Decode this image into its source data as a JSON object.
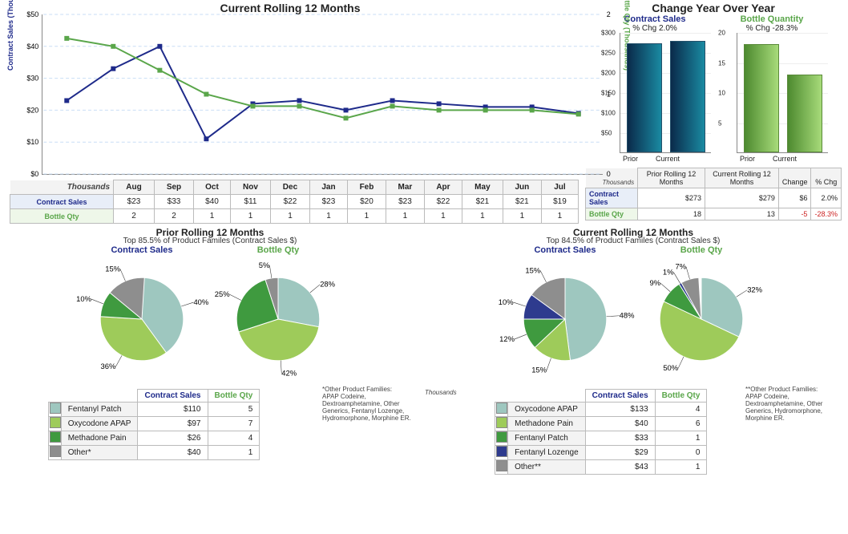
{
  "colors": {
    "teal": "#9ec7bf",
    "lime": "#9ecb5a",
    "green": "#3f9a3f",
    "navy": "#2e3b8e",
    "grey": "#8e8e8e"
  },
  "chart_data": [
    {
      "id": "rolling12",
      "type": "line",
      "title": "Current Rolling 12 Months",
      "x": [
        "Aug",
        "Sep",
        "Oct",
        "Nov",
        "Dec",
        "Jan",
        "Feb",
        "Mar",
        "Apr",
        "May",
        "Jun",
        "Jul"
      ],
      "y1": {
        "label": "Contract Sales (Thousands)",
        "ylim": [
          0,
          50
        ],
        "ticks": [
          "$0",
          "$10",
          "$20",
          "$30",
          "$40",
          "$50"
        ]
      },
      "y2": {
        "label": "Bottle Qty (Thousands)",
        "ylim": [
          0,
          2
        ],
        "ticks": [
          "0",
          "1",
          "2"
        ]
      },
      "series": [
        {
          "name": "Contract Sales",
          "axis": "y1",
          "color": "#1e2a8a",
          "values": [
            23,
            33,
            40,
            11,
            22,
            23,
            20,
            23,
            22,
            21,
            21,
            19
          ]
        },
        {
          "name": "Bottle Qty",
          "axis": "y2",
          "color": "#5aa64a",
          "values": [
            1.7,
            1.6,
            1.3,
            1.0,
            0.85,
            0.85,
            0.7,
            0.85,
            0.8,
            0.8,
            0.8,
            0.75
          ]
        }
      ]
    },
    {
      "id": "yoy_sales",
      "type": "bar",
      "title": "Contract Sales",
      "subtitle": "% Chg 2.0%",
      "categories": [
        "Prior",
        "Current"
      ],
      "values": [
        273,
        279
      ],
      "ylim": [
        0,
        300
      ],
      "ticks": [
        "$50",
        "$100",
        "$150",
        "$200",
        "$250",
        "$300"
      ]
    },
    {
      "id": "yoy_qty",
      "type": "bar",
      "title": "Bottle Quantity",
      "subtitle": "% Chg -28.3%",
      "categories": [
        "Prior",
        "Current"
      ],
      "values": [
        18,
        13
      ],
      "ylim": [
        0,
        20
      ],
      "ticks": [
        "5",
        "10",
        "15",
        "20"
      ]
    },
    {
      "id": "prior_sales_pie",
      "type": "pie",
      "title": "Contract Sales",
      "slices": [
        {
          "label": "Fentanyl Patch",
          "pct": 40,
          "color": "teal"
        },
        {
          "label": "Oxycodone APAP",
          "pct": 36,
          "color": "lime"
        },
        {
          "label": "Methadone Pain",
          "pct": 10,
          "color": "green"
        },
        {
          "label": "Other*",
          "pct": 15,
          "color": "grey"
        }
      ]
    },
    {
      "id": "prior_qty_pie",
      "type": "pie",
      "title": "Bottle Qty",
      "slices": [
        {
          "label": "Fentanyl Patch",
          "pct": 28,
          "color": "teal"
        },
        {
          "label": "Oxycodone APAP",
          "pct": 42,
          "color": "lime"
        },
        {
          "label": "Methadone Pain",
          "pct": 25,
          "color": "green"
        },
        {
          "label": "Other*",
          "pct": 5,
          "color": "grey"
        }
      ]
    },
    {
      "id": "curr_sales_pie",
      "type": "pie",
      "title": "Contract Sales",
      "slices": [
        {
          "label": "Oxycodone APAP",
          "pct": 48,
          "color": "teal"
        },
        {
          "label": "Methadone Pain",
          "pct": 15,
          "color": "lime"
        },
        {
          "label": "Fentanyl Patch",
          "pct": 12,
          "color": "green"
        },
        {
          "label": "Fentanyl Lozenge",
          "pct": 10,
          "color": "navy"
        },
        {
          "label": "Other**",
          "pct": 15,
          "color": "grey"
        }
      ]
    },
    {
      "id": "curr_qty_pie",
      "type": "pie",
      "title": "Bottle Qty",
      "slices": [
        {
          "label": "Oxycodone APAP",
          "pct": 32,
          "color": "teal"
        },
        {
          "label": "Methadone Pain",
          "pct": 50,
          "color": "lime"
        },
        {
          "label": "Fentanyl Patch",
          "pct": 9,
          "color": "green"
        },
        {
          "label": "Fentanyl Lozenge",
          "pct": 1,
          "color": "navy"
        },
        {
          "label": "Other**",
          "pct": 7,
          "color": "grey"
        }
      ]
    }
  ],
  "header": {
    "main_title": "Current Rolling 12 Months",
    "right_title": "Change Year Over Year",
    "thousands": "Thousands"
  },
  "month_table": {
    "months": [
      "Aug",
      "Sep",
      "Oct",
      "Nov",
      "Dec",
      "Jan",
      "Feb",
      "Mar",
      "Apr",
      "May",
      "Jun",
      "Jul"
    ],
    "rows": {
      "contract_sales": {
        "label": "Contract Sales",
        "values": [
          "$23",
          "$33",
          "$40",
          "$11",
          "$22",
          "$23",
          "$20",
          "$23",
          "$22",
          "$21",
          "$21",
          "$19"
        ]
      },
      "bottle_qty": {
        "label": "Bottle Qty",
        "values": [
          "2",
          "2",
          "1",
          "1",
          "1",
          "1",
          "1",
          "1",
          "1",
          "1",
          "1",
          "1"
        ]
      }
    }
  },
  "summary_table": {
    "cols": [
      "Prior Rolling 12 Months",
      "Current Rolling 12 Months",
      "Change",
      "% Chg"
    ],
    "rows": [
      {
        "label": "Contract Sales",
        "class": "cs",
        "cells": [
          "$273",
          "$279",
          "$6",
          "2.0%"
        ],
        "chg_class": ""
      },
      {
        "label": "Bottle Qty",
        "class": "bq",
        "cells": [
          "18",
          "13",
          "-5",
          "-28.3%"
        ],
        "chg_class": "red"
      }
    ]
  },
  "prior_section": {
    "title": "Prior Rolling 12 Months",
    "subtitle": "Top 85.5% of Product Familes (Contract Sales $)",
    "sales_label": "Contract Sales",
    "qty_label": "Bottle Qty",
    "table": {
      "cols": [
        "Contract Sales",
        "Bottle Qty"
      ],
      "rows": [
        {
          "color": "teal",
          "name": "Fentanyl Patch",
          "cs": "$110",
          "bq": "5"
        },
        {
          "color": "lime",
          "name": "Oxycodone APAP",
          "cs": "$97",
          "bq": "7"
        },
        {
          "color": "green",
          "name": "Methadone Pain",
          "cs": "$26",
          "bq": "4"
        },
        {
          "color": "grey",
          "name": "Other*",
          "cs": "$40",
          "bq": "1"
        }
      ]
    },
    "footnote": "*Other Product Families:\nAPAP Codeine, Dextroamphetamine, Other Generics, Fentanyl Lozenge, Hydromorphone, Morphine ER."
  },
  "current_section": {
    "title": "Current Rolling 12 Months",
    "subtitle": "Top 84.5% of Product Familes (Contract Sales $)",
    "sales_label": "Contract Sales",
    "qty_label": "Bottle Qty",
    "table": {
      "cols": [
        "Contract Sales",
        "Bottle Qty"
      ],
      "rows": [
        {
          "color": "teal",
          "name": "Oxycodone APAP",
          "cs": "$133",
          "bq": "4"
        },
        {
          "color": "lime",
          "name": "Methadone Pain",
          "cs": "$40",
          "bq": "6"
        },
        {
          "color": "green",
          "name": "Fentanyl Patch",
          "cs": "$33",
          "bq": "1"
        },
        {
          "color": "navy",
          "name": "Fentanyl Lozenge",
          "cs": "$29",
          "bq": "0"
        },
        {
          "color": "grey",
          "name": "Other**",
          "cs": "$43",
          "bq": "1"
        }
      ]
    },
    "footnote": "**Other Product Families:\nAPAP Codeine, Dextroamphetamine, Other Generics, Hydromorphone, Morphine ER."
  }
}
